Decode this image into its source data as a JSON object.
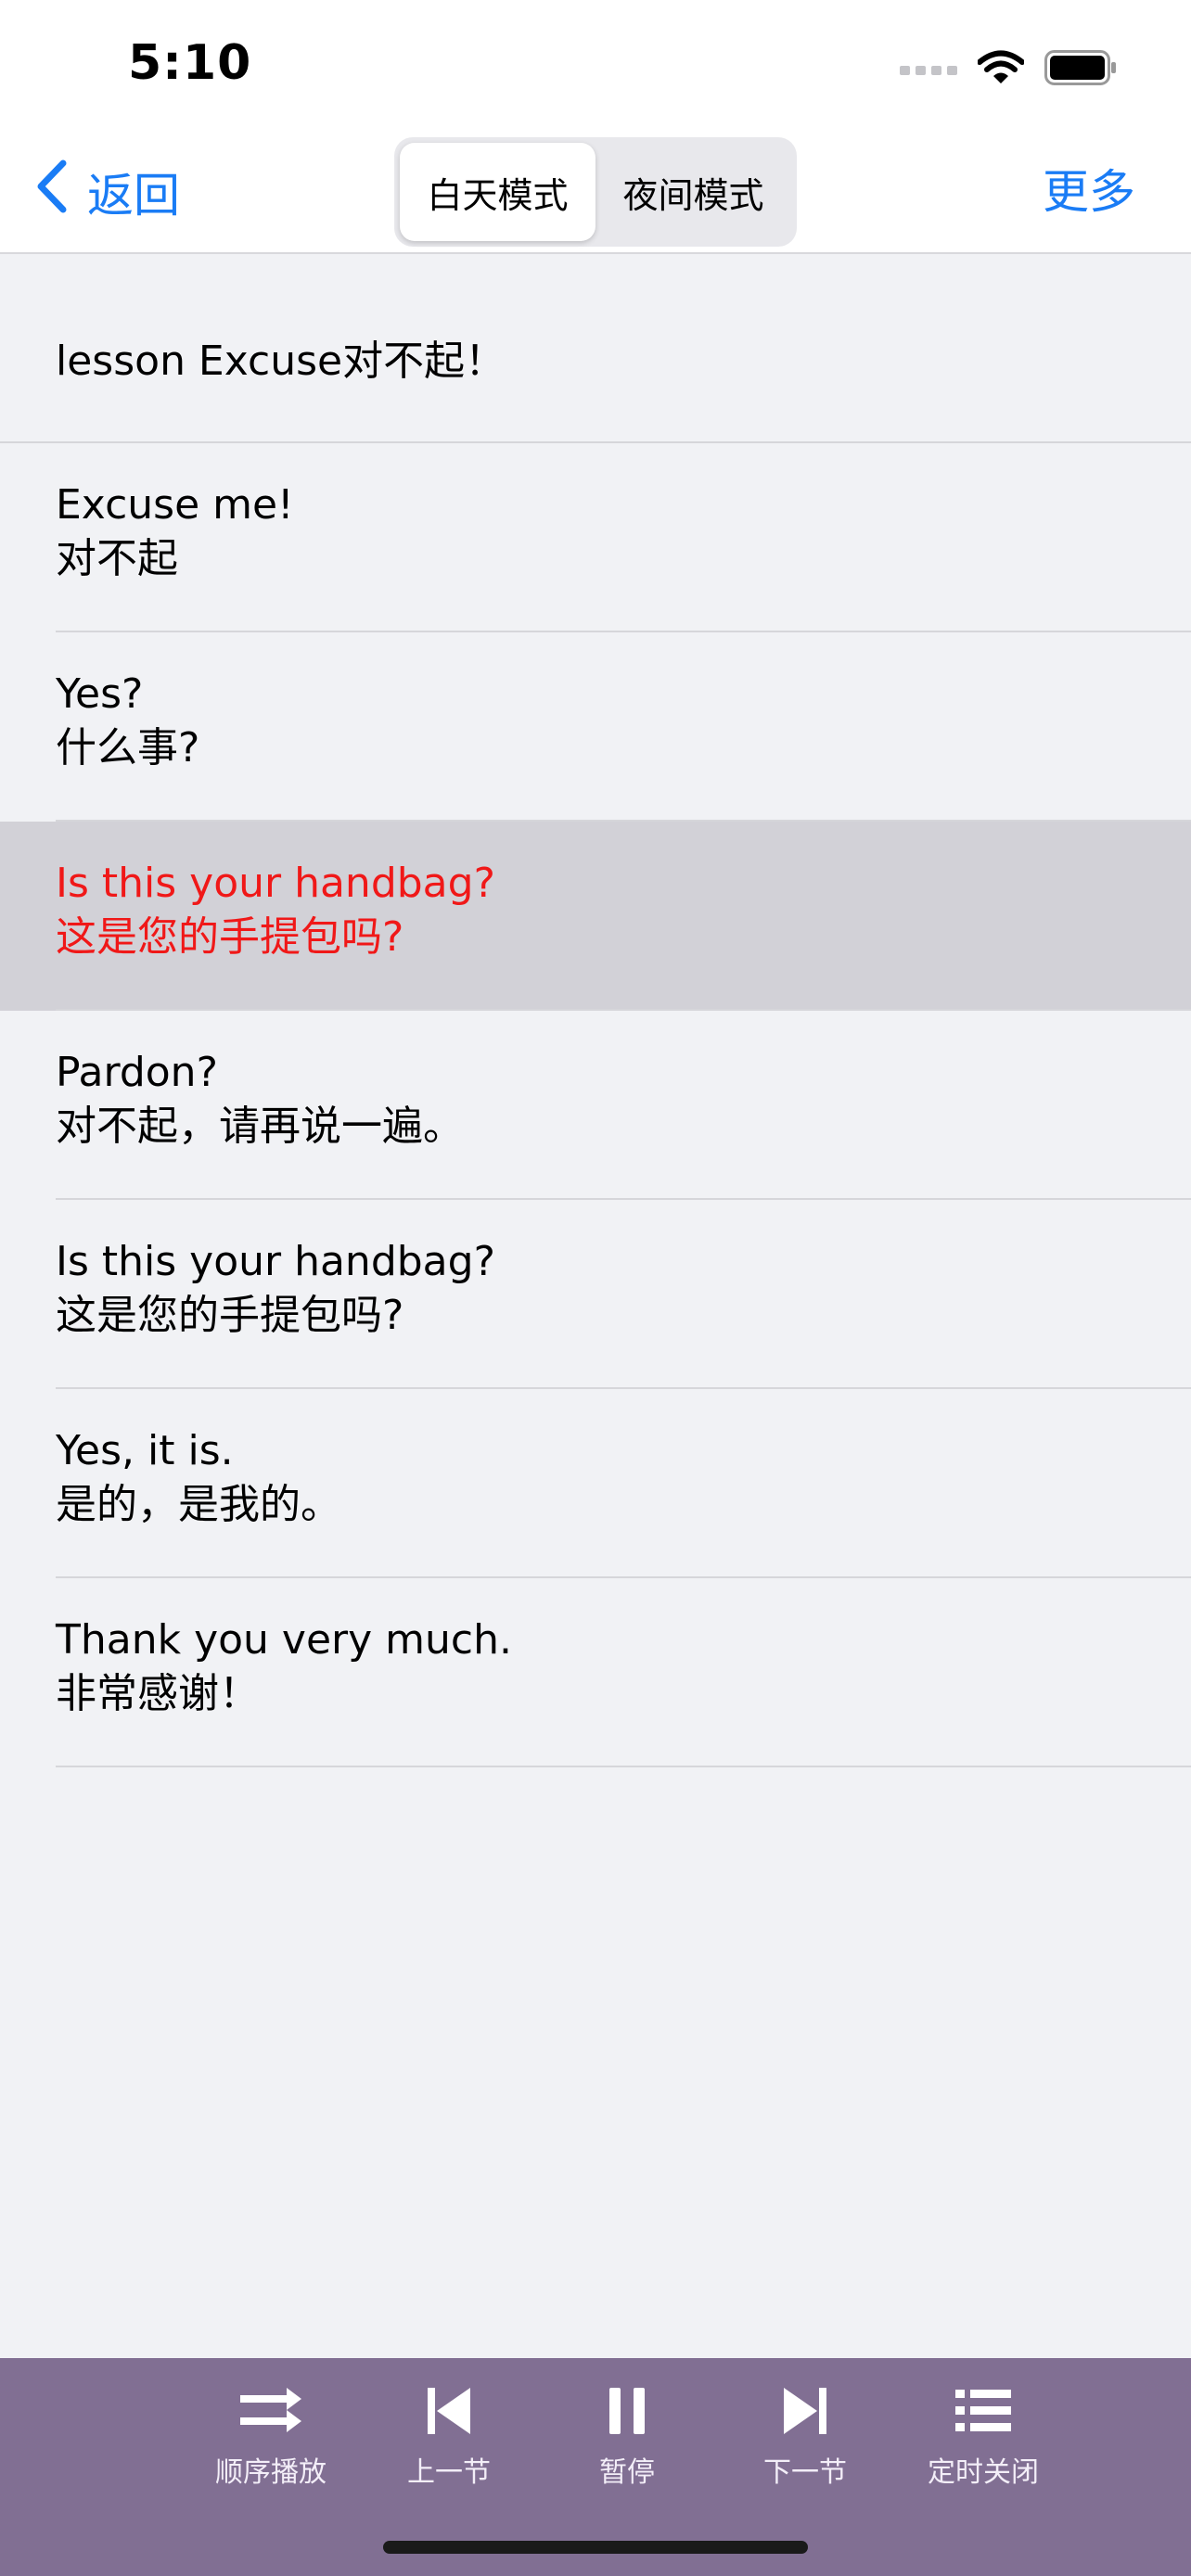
{
  "status": {
    "time": "5:10"
  },
  "nav": {
    "back_label": "返回",
    "more_label": "更多",
    "segments": [
      "白天模式",
      "夜间模式"
    ],
    "selected_segment": "白天模式"
  },
  "lesson": {
    "title": "lesson Excuse对不起！",
    "rows": [
      {
        "en": "Excuse me!",
        "zh": "对不起"
      },
      {
        "en": "Yes?",
        "zh": "什么事?"
      },
      {
        "en": "Is this your handbag?",
        "zh": "这是您的手提包吗?"
      },
      {
        "en": "Pardon?",
        "zh": "对不起，请再说一遍。"
      },
      {
        "en": "Is this your handbag?",
        "zh": "这是您的手提包吗?"
      },
      {
        "en": "Yes, it is.",
        "zh": "是的，是我的。"
      },
      {
        "en": "Thank you very much.",
        "zh": "非常感谢！"
      }
    ]
  },
  "player": {
    "order_label": "顺序播放",
    "prev_label": "上一节",
    "pause_label": "暂停",
    "next_label": "下一节",
    "timer_label": "定时关闭"
  },
  "colors": {
    "accent": "#1a7cf5",
    "highlight_text": "#f01818",
    "highlight_row": "#d2d1d7",
    "player_bg": "#816f93"
  }
}
